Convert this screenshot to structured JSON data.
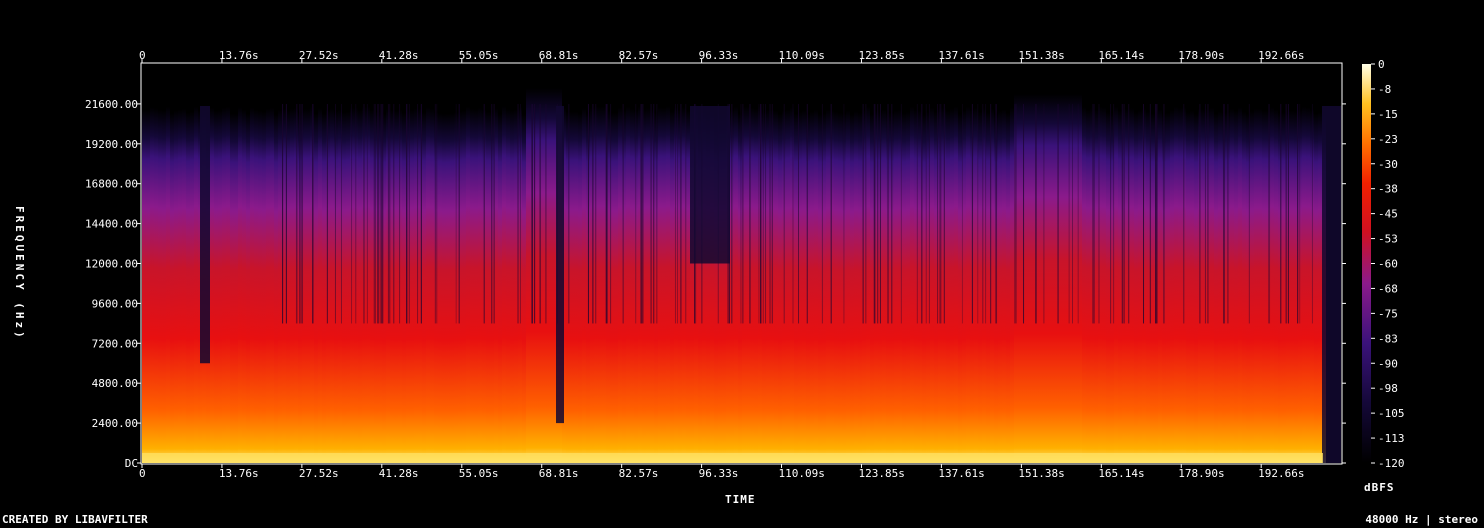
{
  "footer": {
    "credit": "CREATED BY LIBAVFILTER",
    "info": "48000 Hz | stereo"
  },
  "chart_data": {
    "type": "heatmap",
    "xlabel": "TIME",
    "ylabel": "FREQUENCY (Hz)",
    "colorbar_label": "dBFS",
    "x_ticks": [
      "0",
      "13.76s",
      "27.52s",
      "41.28s",
      "55.05s",
      "68.81s",
      "82.57s",
      "96.33s",
      "110.09s",
      "123.85s",
      "137.61s",
      "151.38s",
      "165.14s",
      "178.90s",
      "192.66s"
    ],
    "y_ticks": [
      "DC",
      "2400.00",
      "4800.00",
      "7200.00",
      "9600.00",
      "12000.00",
      "14400.00",
      "16800.00",
      "19200.00",
      "21600.00"
    ],
    "y_tick_values": [
      0,
      2400,
      4800,
      7200,
      9600,
      12000,
      14400,
      16800,
      19200,
      21600
    ],
    "x_tick_values": [
      0,
      13.76,
      27.52,
      41.28,
      55.05,
      68.81,
      82.57,
      96.33,
      110.09,
      123.85,
      137.61,
      151.38,
      165.14,
      178.9,
      192.66
    ],
    "xlim": [
      0,
      206.4
    ],
    "ylim": [
      0,
      24000
    ],
    "colorbar_ticks": [
      "0",
      "-8",
      "-15",
      "-23",
      "-30",
      "-38",
      "-45",
      "-53",
      "-60",
      "-68",
      "-75",
      "-83",
      "-90",
      "-98",
      "-105",
      "-113",
      "-120"
    ],
    "colorbar_range": [
      -120,
      0
    ],
    "colormap": [
      "#000000",
      "#1a0a4a",
      "#4a148c",
      "#8b1a8b",
      "#c0182a",
      "#e81010",
      "#ff5a00",
      "#ffb000",
      "#ffe060",
      "#ffffd0"
    ]
  }
}
